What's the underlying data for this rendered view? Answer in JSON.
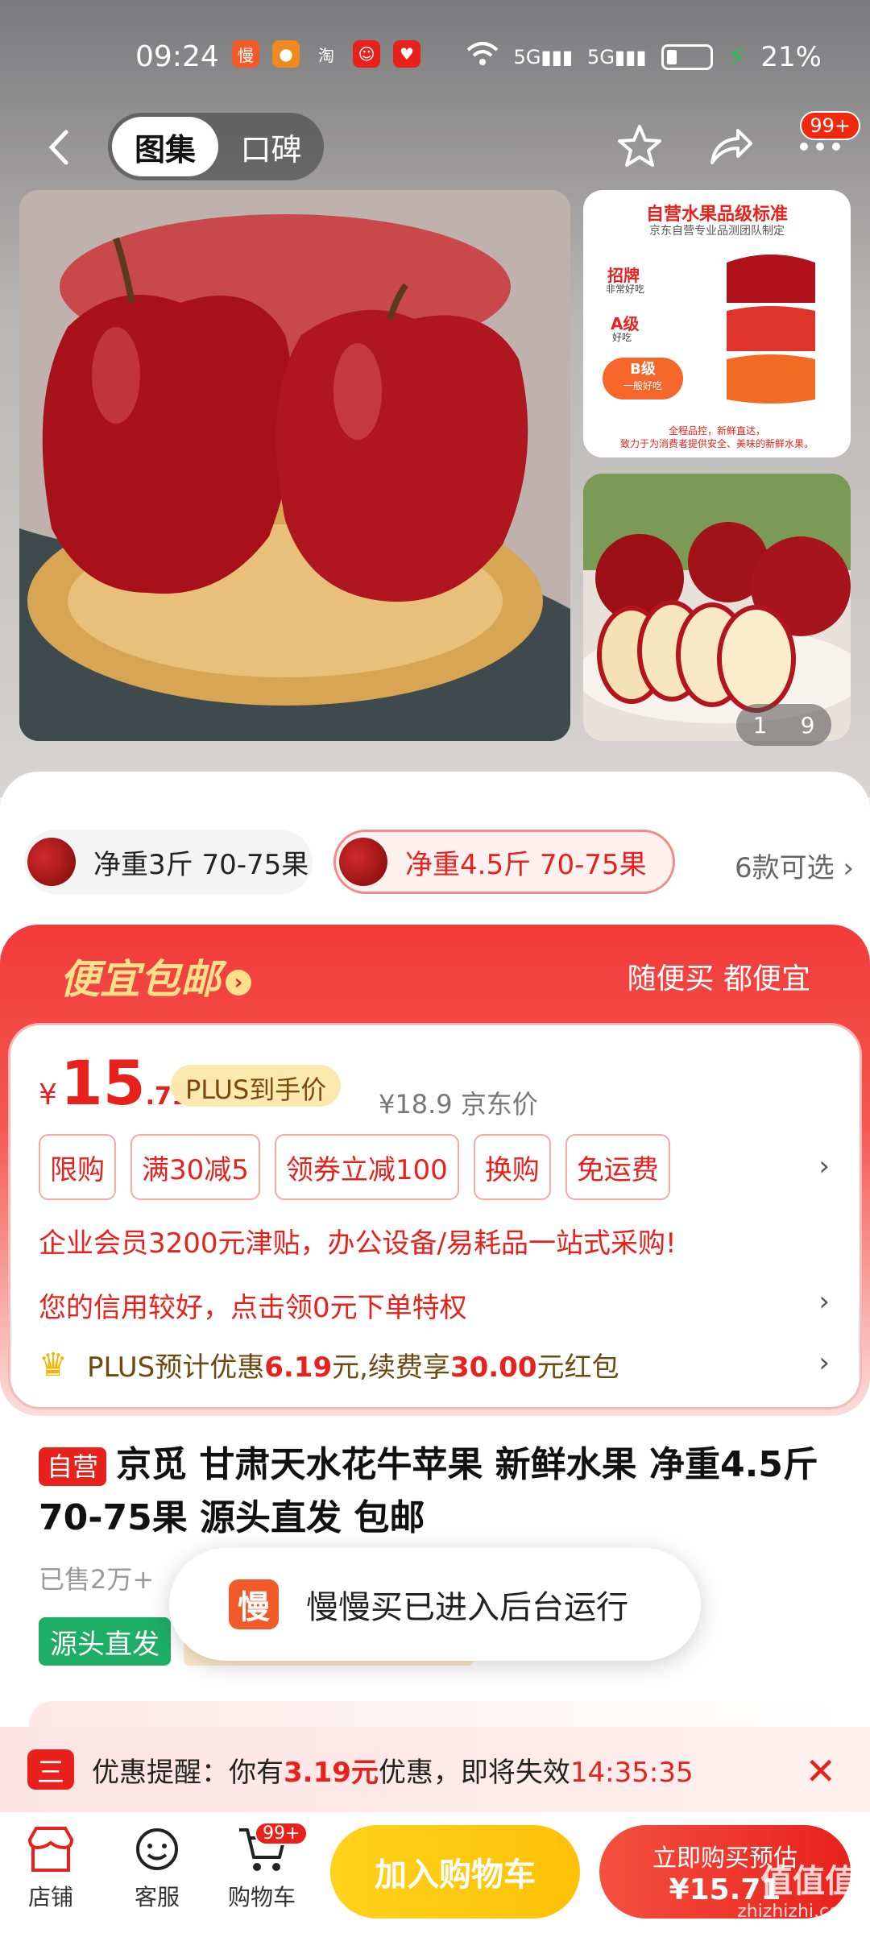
{
  "status": {
    "time": "09:24",
    "battery": "21%",
    "net1": "5G",
    "net2": "5G"
  },
  "status_apps": [
    {
      "name": "manmanmai-app-icon",
      "text": "慢",
      "color": "#f25a29"
    },
    {
      "name": "notify-app-icon-2",
      "text": "●",
      "color": "#f08a1f"
    },
    {
      "name": "taobao-app-icon",
      "text": "淘",
      "color": "transparent"
    },
    {
      "name": "jd-app-icon",
      "text": "☺",
      "color": "#e8211c"
    },
    {
      "name": "pinduoduo-app-icon",
      "text": "♥",
      "color": "#e8211c"
    }
  ],
  "nav": {
    "tab_gallery": "图集",
    "tab_reviews": "口碑",
    "badge": "99+"
  },
  "gallery": {
    "side_title": "自营水果品级标准",
    "side_sub": "京东自营专业品测团队制定",
    "grade1": "招牌",
    "grade1_sub": "非常好吃",
    "grade2": "A级",
    "grade2_sub": "好吃",
    "grade3": "B级",
    "grade3_sub": "一般好吃",
    "side_foot1": "全程品控，新鲜直达，",
    "side_foot2": "致力于为消费者提供安全、美味的新鲜水果。",
    "counter_current": "1",
    "counter_total": "9"
  },
  "variants": {
    "v1": "净重3斤 70-75果",
    "v2": "净重4.5斤 70-75果",
    "more": "6款可选",
    "more_arrow": "›"
  },
  "promo": {
    "title": "便宜包邮",
    "arrow": "›",
    "slogan": "随便买 都便宜",
    "currency": "¥",
    "price_int": "15",
    "price_dec": ".71",
    "plus_label": "PLUS到手价",
    "jd_price": "¥18.9 京东价",
    "tags": [
      "限购",
      "满30减5",
      "领券立减100",
      "换购",
      "免运费"
    ],
    "chev": "›",
    "enterprise": "企业会员3200元津贴，办公设备/易耗品一站式采购!",
    "credit": "您的信用较好，点击领0元下单特权",
    "plus_prefix": "PLUS预计优惠",
    "plus_amount": "6.19",
    "plus_mid": "元,续费享",
    "plus_red": "30.00",
    "plus_suffix": "元红包"
  },
  "product": {
    "self_tag": "自营",
    "title": "京觅 甘肃天水花牛苹果 新鲜水果 净重4.5斤 70-75果 源头直发 包邮",
    "sold": "已售2万+",
    "source_tag": "源头直发"
  },
  "toast": {
    "icon": "慢",
    "text": "慢慢买已进入后台运行"
  },
  "reminder": {
    "icon": "三",
    "prefix": "优惠提醒：你有",
    "amount": "3.19元",
    "mid": "优惠，即将失效",
    "timer": "14:35:35",
    "close": "✕"
  },
  "bottom": {
    "shop": "店铺",
    "service": "客服",
    "cart": "购物车",
    "cart_badge": "99+",
    "add_cart": "加入购物车",
    "buy_line1": "立即购买预估",
    "buy_line2": "¥15.71"
  },
  "watermark": {
    "main": "值值值",
    "sub": "zhizhizhi.com"
  },
  "colors": {
    "accent": "#e8211c",
    "plus_gold": "#fbe9b0",
    "cart_yellow": "#ffc107",
    "source_green": "#1fae66"
  }
}
